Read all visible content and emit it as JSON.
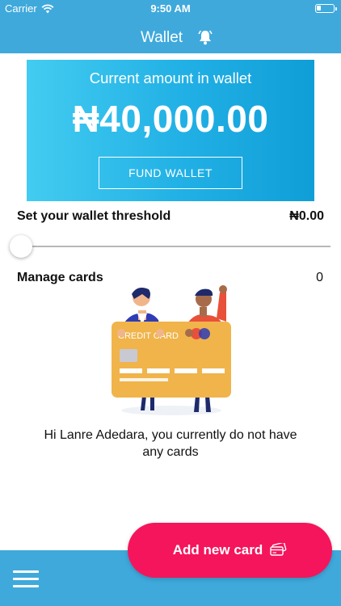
{
  "status_bar": {
    "carrier": "Carrier",
    "time": "9:50 AM"
  },
  "nav": {
    "title": "Wallet",
    "icon": "bell-icon"
  },
  "wallet": {
    "label": "Current amount in wallet",
    "amount": "₦40,000.00",
    "fund_button": "FUND WALLET"
  },
  "threshold": {
    "label": "Set your wallet threshold",
    "value": "₦0.00",
    "slider_level": 0
  },
  "cards": {
    "label": "Manage cards",
    "count": "0",
    "illustration_text": "CREDIT CARD",
    "empty_message": "Hi Lanre Adedara, you currently do not have any cards"
  },
  "actions": {
    "add_card": "Add new card",
    "add_card_icon": "credit-card-icon",
    "menu_icon": "hamburger-menu-icon"
  },
  "colors": {
    "primary": "#3fa9dc",
    "card_gradient_start": "#43ccf1",
    "card_gradient_end": "#109ed7",
    "accent": "#f5155c"
  }
}
